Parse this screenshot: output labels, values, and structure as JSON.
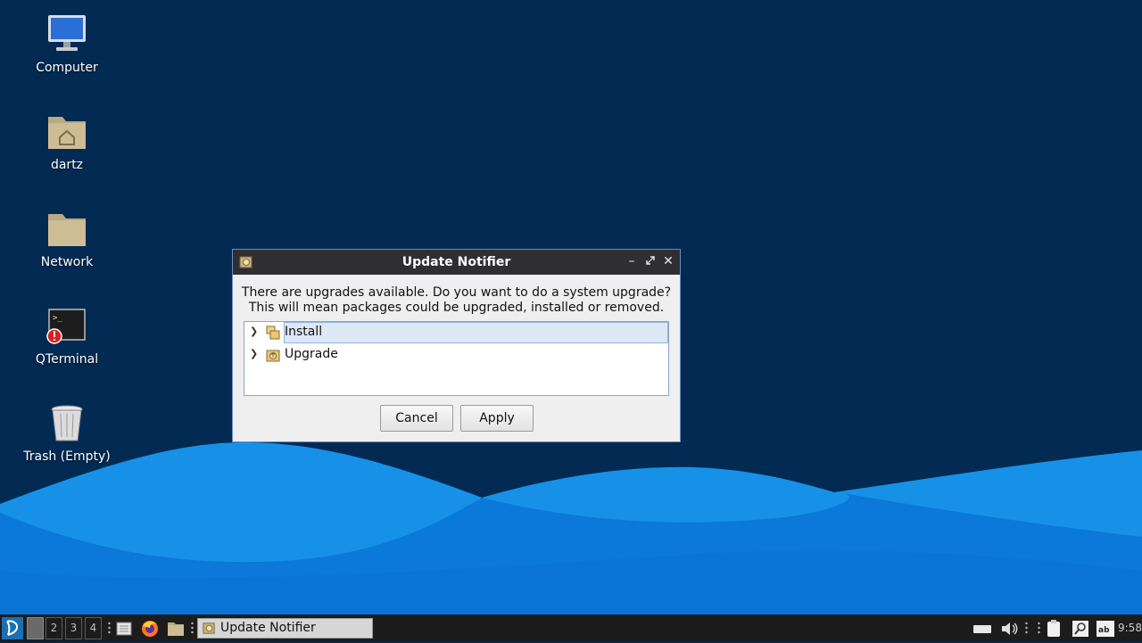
{
  "desktop": {
    "icons": [
      {
        "label": "Computer",
        "icon": "computer-icon"
      },
      {
        "label": "dartz",
        "icon": "home-folder-icon"
      },
      {
        "label": "Network",
        "icon": "folder-icon"
      },
      {
        "label": "QTerminal",
        "icon": "terminal-icon"
      },
      {
        "label": "Trash (Empty)",
        "icon": "trash-icon"
      }
    ]
  },
  "dialog": {
    "title": "Update Notifier",
    "message_line1": "There are upgrades available. Do you want to do a system upgrade?",
    "message_line2": "This will mean packages could be upgraded, installed or removed.",
    "tree_items": [
      {
        "label": "Install",
        "selected": true
      },
      {
        "label": "Upgrade",
        "selected": false
      }
    ],
    "cancel_label": "Cancel",
    "apply_label": "Apply"
  },
  "taskbar": {
    "desktops": [
      "2",
      "3",
      "4"
    ],
    "active_task": "Update Notifier",
    "clock": "9:58"
  },
  "colors": {
    "background": "#032a52",
    "wave_light": "#2aa0ee",
    "wave_dark": "#0a78d8",
    "titlebar": "#2e2e33"
  }
}
